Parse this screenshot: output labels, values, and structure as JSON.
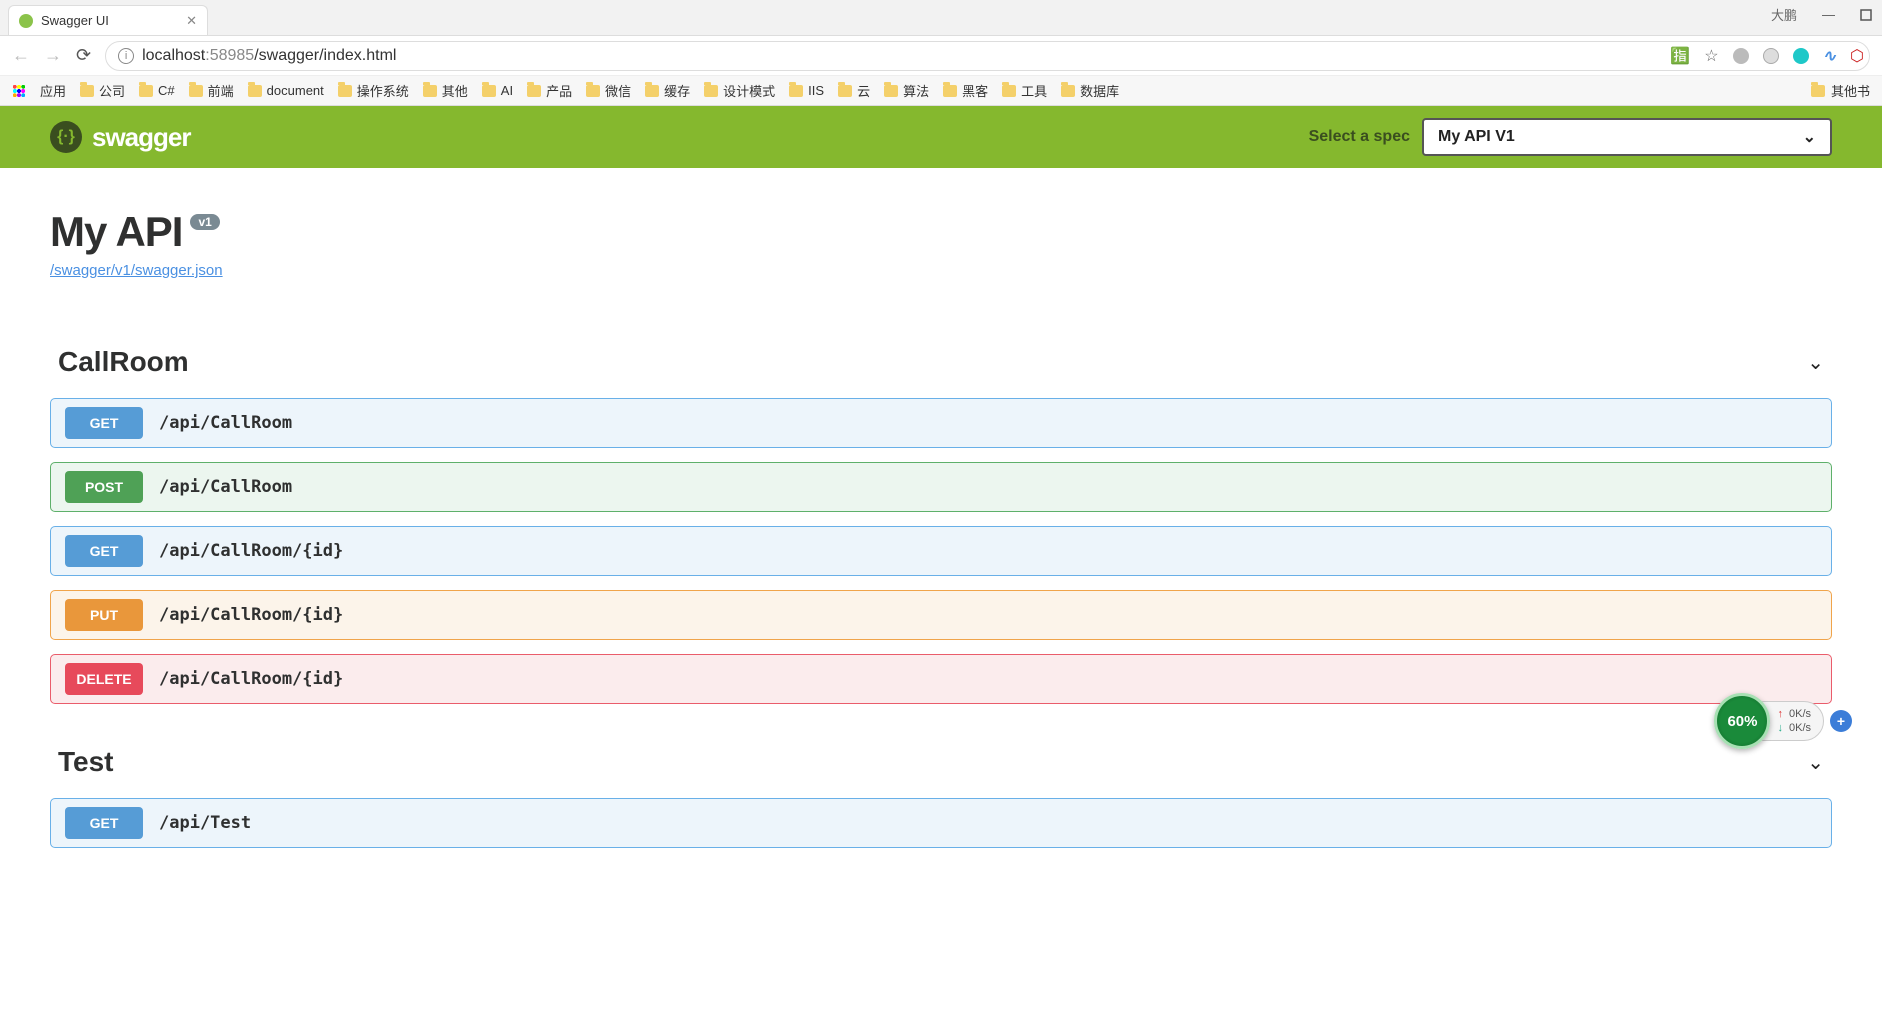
{
  "browser": {
    "tab_title": "Swagger UI",
    "url_host": "localhost",
    "url_port": ":58985",
    "url_path": "/swagger/index.html",
    "window_user": "大鹏"
  },
  "bookmarks": {
    "apps_label": "应用",
    "items": [
      "公司",
      "C#",
      "前端",
      "document",
      "操作系统",
      "其他",
      "AI",
      "产品",
      "微信",
      "缓存",
      "设计模式",
      "IIS",
      "云",
      "算法",
      "黑客",
      "工具",
      "数据库"
    ],
    "overflow_label": "其他书"
  },
  "topbar": {
    "brand": "swagger",
    "select_label": "Select a spec",
    "selected_spec": "My API V1"
  },
  "page": {
    "api_title": "My API",
    "version": "v1",
    "spec_link": "/swagger/v1/swagger.json"
  },
  "sections": [
    {
      "name": "CallRoom",
      "ops": [
        {
          "method": "GET",
          "path": "/api/CallRoom",
          "cls": "get"
        },
        {
          "method": "POST",
          "path": "/api/CallRoom",
          "cls": "post"
        },
        {
          "method": "GET",
          "path": "/api/CallRoom/{id}",
          "cls": "get"
        },
        {
          "method": "PUT",
          "path": "/api/CallRoom/{id}",
          "cls": "put"
        },
        {
          "method": "DELETE",
          "path": "/api/CallRoom/{id}",
          "cls": "delete"
        }
      ]
    },
    {
      "name": "Test",
      "ops": [
        {
          "method": "GET",
          "path": "/api/Test",
          "cls": "get"
        }
      ]
    }
  ],
  "netwidget": {
    "percent": "60%",
    "up": "0K/s",
    "down": "0K/s"
  }
}
